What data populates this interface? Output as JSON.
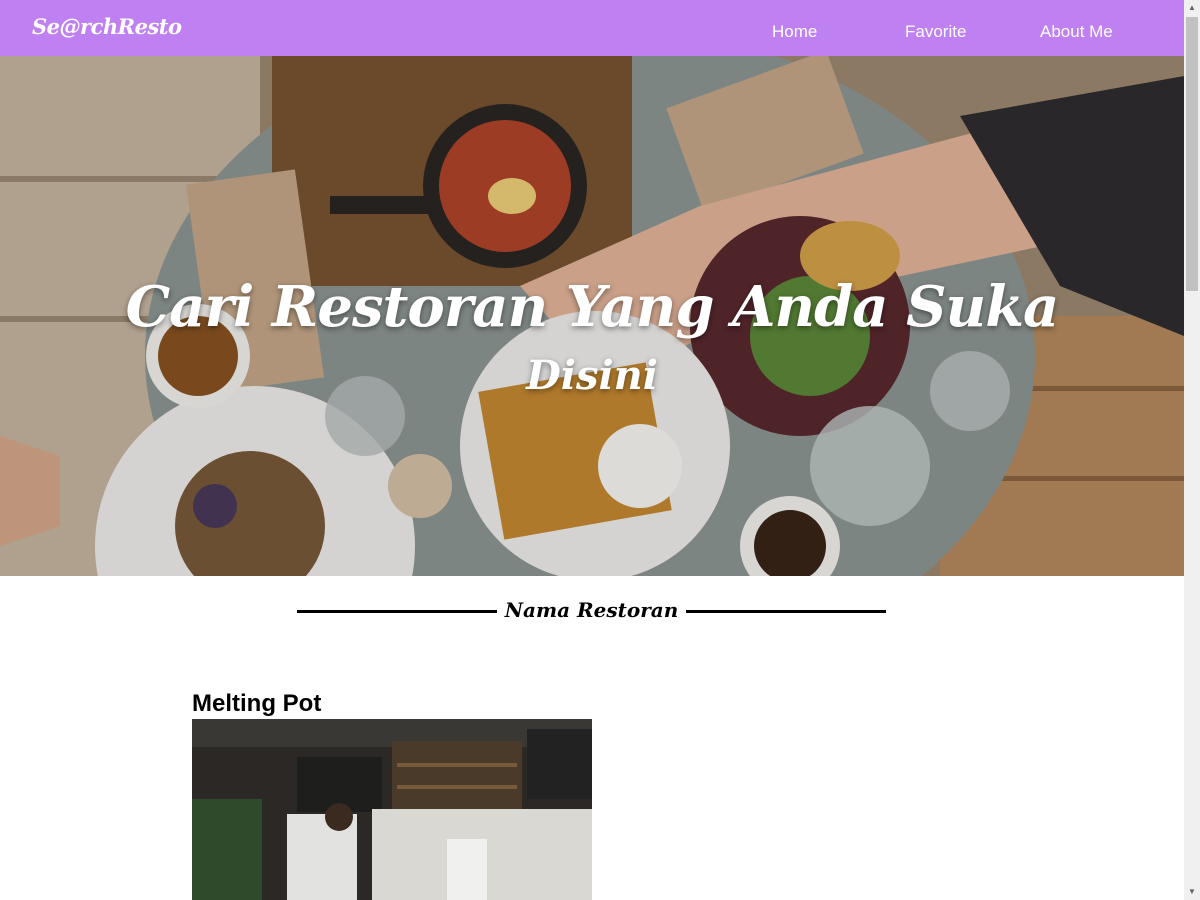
{
  "navbar": {
    "brand": "Se@rchResto",
    "links": {
      "home": "Home",
      "favorite": "Favorite",
      "about": "About Me"
    },
    "color": "#bf80f2"
  },
  "hero": {
    "title": "Cari Restoran Yang Anda Suka",
    "subtitle": "Disini"
  },
  "section": {
    "title": "Nama Restoran"
  },
  "restaurants": [
    {
      "name": "Melting Pot"
    }
  ],
  "scrollbar": {
    "up_icon": "triangle-up",
    "down_icon": "triangle-down"
  }
}
